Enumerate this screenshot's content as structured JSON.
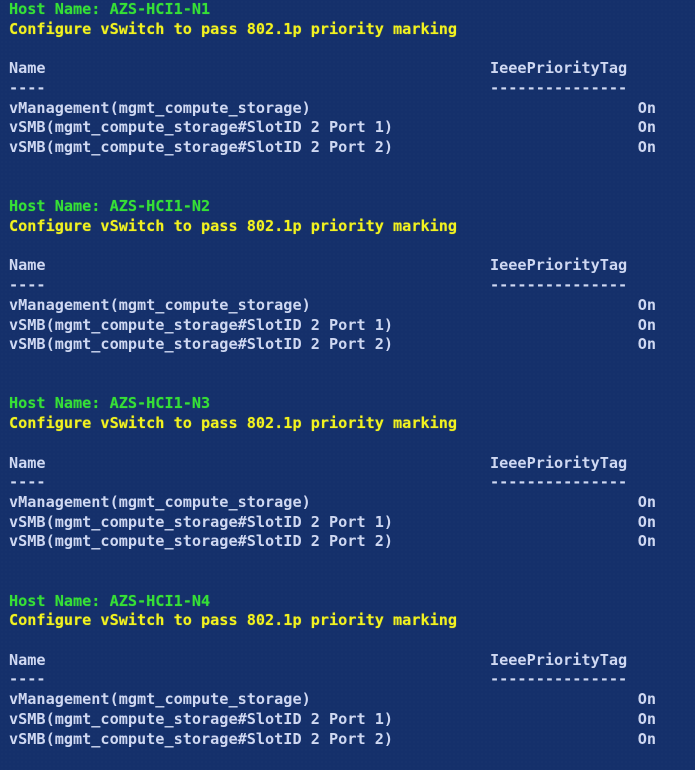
{
  "console": {
    "type": "powershell-console",
    "background_color": "#15306b",
    "host_line_color": "#36e036",
    "task_line_color": "#f2f21f",
    "table_text_color": "#cfd8f2",
    "host_label_prefix": "Host Name: ",
    "task_message": "Configure vSwitch to pass 802.1p priority marking",
    "table": {
      "headers": [
        "Name",
        "IeeePriorityTag"
      ],
      "separators": [
        "----",
        "---------------"
      ]
    },
    "blocks": [
      {
        "host_line": "Host Name: AZS-HCI1-N1",
        "host_name": "AZS-HCI1-N1",
        "task_line": "Configure vSwitch to pass 802.1p priority marking",
        "header_name": "Name",
        "header_tag": "IeeePriorityTag",
        "sep_name": "----",
        "sep_tag": "---------------",
        "rows": [
          {
            "name": "vManagement(mgmt_compute_storage)",
            "tag": "On"
          },
          {
            "name": "vSMB(mgmt_compute_storage#SlotID 2 Port 1)",
            "tag": "On"
          },
          {
            "name": "vSMB(mgmt_compute_storage#SlotID 2 Port 2)",
            "tag": "On"
          }
        ]
      },
      {
        "host_line": "Host Name: AZS-HCI1-N2",
        "host_name": "AZS-HCI1-N2",
        "task_line": "Configure vSwitch to pass 802.1p priority marking",
        "header_name": "Name",
        "header_tag": "IeeePriorityTag",
        "sep_name": "----",
        "sep_tag": "---------------",
        "rows": [
          {
            "name": "vManagement(mgmt_compute_storage)",
            "tag": "On"
          },
          {
            "name": "vSMB(mgmt_compute_storage#SlotID 2 Port 1)",
            "tag": "On"
          },
          {
            "name": "vSMB(mgmt_compute_storage#SlotID 2 Port 2)",
            "tag": "On"
          }
        ]
      },
      {
        "host_line": "Host Name: AZS-HCI1-N3",
        "host_name": "AZS-HCI1-N3",
        "task_line": "Configure vSwitch to pass 802.1p priority marking",
        "header_name": "Name",
        "header_tag": "IeeePriorityTag",
        "sep_name": "----",
        "sep_tag": "---------------",
        "rows": [
          {
            "name": "vManagement(mgmt_compute_storage)",
            "tag": "On"
          },
          {
            "name": "vSMB(mgmt_compute_storage#SlotID 2 Port 1)",
            "tag": "On"
          },
          {
            "name": "vSMB(mgmt_compute_storage#SlotID 2 Port 2)",
            "tag": "On"
          }
        ]
      },
      {
        "host_line": "Host Name: AZS-HCI1-N4",
        "host_name": "AZS-HCI1-N4",
        "task_line": "Configure vSwitch to pass 802.1p priority marking",
        "header_name": "Name",
        "header_tag": "IeeePriorityTag",
        "sep_name": "----",
        "sep_tag": "---------------",
        "rows": [
          {
            "name": "vManagement(mgmt_compute_storage)",
            "tag": "On"
          },
          {
            "name": "vSMB(mgmt_compute_storage#SlotID 2 Port 1)",
            "tag": "On"
          },
          {
            "name": "vSMB(mgmt_compute_storage#SlotID 2 Port 2)",
            "tag": "On"
          }
        ]
      }
    ]
  }
}
